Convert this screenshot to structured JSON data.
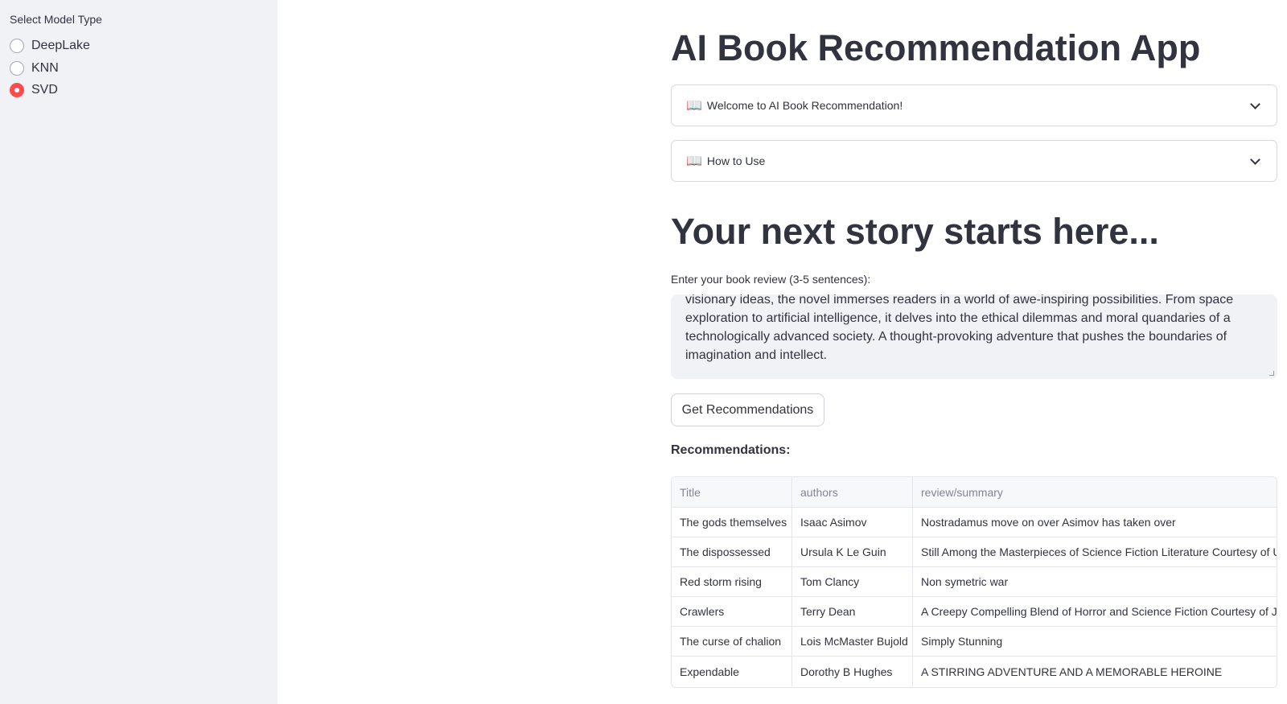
{
  "sidebar": {
    "label": "Select Model Type",
    "options": [
      {
        "label": "DeepLake",
        "selected": false
      },
      {
        "label": "KNN",
        "selected": false
      },
      {
        "label": "SVD",
        "selected": true
      }
    ]
  },
  "main": {
    "title": "AI Book Recommendation App",
    "expanders": [
      {
        "icon": "📖",
        "label": "Welcome to AI Book Recommendation!"
      },
      {
        "icon": "📖",
        "label": "How to Use"
      }
    ],
    "heading": "Your next story starts here...",
    "review": {
      "label": "Enter your book review (3-5 sentences):",
      "value": "visionary ideas, the novel immerses readers in a world of awe-inspiring possibilities. From space exploration to artificial intelligence, it delves into the ethical dilemmas and moral quandaries of a technologically advanced society. A thought-provoking adventure that pushes the boundaries of imagination and intellect."
    },
    "button_label": "Get Recommendations",
    "recommendations_heading": "Recommendations:",
    "table": {
      "headers": [
        "Title",
        "authors",
        "review/summary"
      ],
      "rows": [
        [
          "The gods themselves",
          "Isaac Asimov",
          "Nostradamus move on over Asimov has taken over"
        ],
        [
          "The dispossessed",
          "Ursula K Le Guin",
          "Still Among the Masterpieces of Science Fiction Literature Courtesy of U"
        ],
        [
          "Red storm rising",
          "Tom Clancy",
          "Non symetric war"
        ],
        [
          "Crawlers",
          "Terry Dean",
          "A Creepy Compelling Blend of Horror and Science Fiction Courtesy of Jo"
        ],
        [
          "The curse of chalion",
          "Lois McMaster Bujold",
          "Simply Stunning"
        ],
        [
          "Expendable",
          "Dorothy B Hughes",
          "A STIRRING ADVENTURE AND A MEMORABLE HEROINE"
        ]
      ]
    }
  },
  "colors": {
    "accent": "#ff4b4b",
    "sidebar_bg": "#f0f2f6",
    "text": "#31333f"
  }
}
